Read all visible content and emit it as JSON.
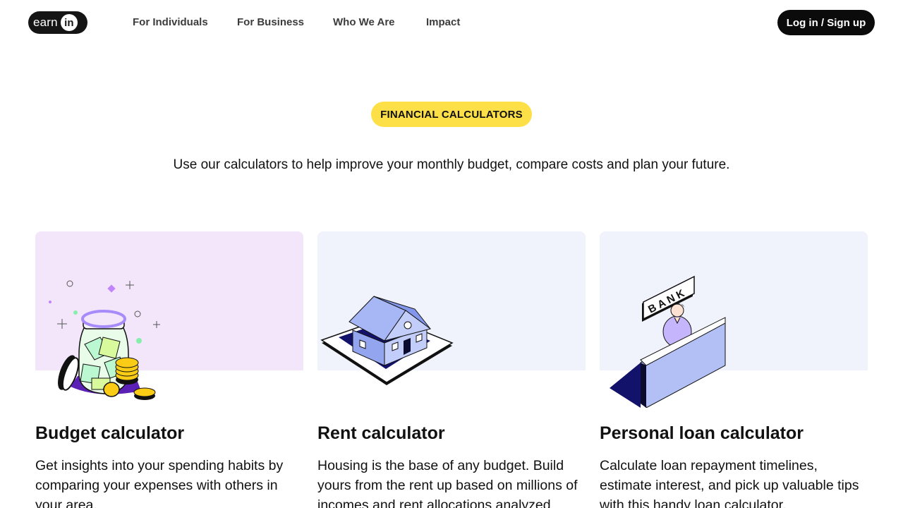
{
  "header": {
    "logo_text": "earn",
    "logo_badge": "in",
    "nav": [
      "For Individuals",
      "For Business",
      "Who We Are",
      "Impact"
    ],
    "login_label": "Log in / Sign up"
  },
  "hero": {
    "badge": "FINANCIAL CALCULATORS",
    "intro": "Use our calculators to help improve your monthly budget, compare costs and plan your future."
  },
  "cards": [
    {
      "title": "Budget calculator",
      "description": "Get insights into your spending habits by comparing your expenses with others in your area.",
      "illustration": "money-jar-icon"
    },
    {
      "title": "Rent calculator",
      "description": "Housing is the base of any budget. Build yours from the rent up based on millions of incomes and rent allocations analyzed",
      "illustration": "house-icon"
    },
    {
      "title": "Personal loan calculator",
      "description": "Calculate loan repayment timelines, estimate interest, and pick up valuable tips with this handy loan calculator.",
      "illustration": "bank-teller-icon",
      "sign_text": "BANK"
    }
  ],
  "colors": {
    "accent_yellow": "#fde047",
    "button_dark": "#0b0b0b",
    "card_lilac": "#f3e6fb",
    "card_blue": "#f1f3fc",
    "illustration_blue": "#b3c0f5",
    "illustration_navy": "#12126b"
  }
}
